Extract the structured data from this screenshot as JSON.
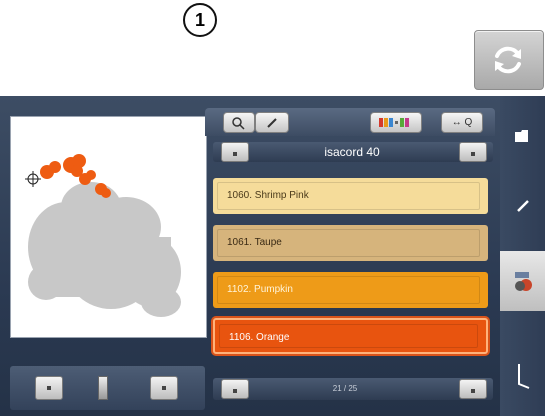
{
  "header": {
    "refresh_icon": "refresh-icon"
  },
  "callout": {
    "number": "1"
  },
  "top_tabs": {
    "zoom_label": "↔ Q"
  },
  "thread_chart": {
    "brand": "isacord 40",
    "colors": [
      {
        "label": "1060. Shrimp Pink",
        "bg": "#f5dc9a",
        "text": "#4a3a1a",
        "selected": false
      },
      {
        "label": "1061. Taupe",
        "bg": "#d6b47c",
        "text": "#3a2a14",
        "selected": false
      },
      {
        "label": "1102. Pumpkin",
        "bg": "#ee9b18",
        "text": "#fff3d8",
        "selected": false
      },
      {
        "label": "1106. Orange",
        "bg": "#e8540f",
        "text": "#ffffff",
        "selected": true
      }
    ],
    "page": "21 / 25"
  },
  "colors": {
    "accent_border": "#d9531a",
    "panel": "#33425a"
  }
}
